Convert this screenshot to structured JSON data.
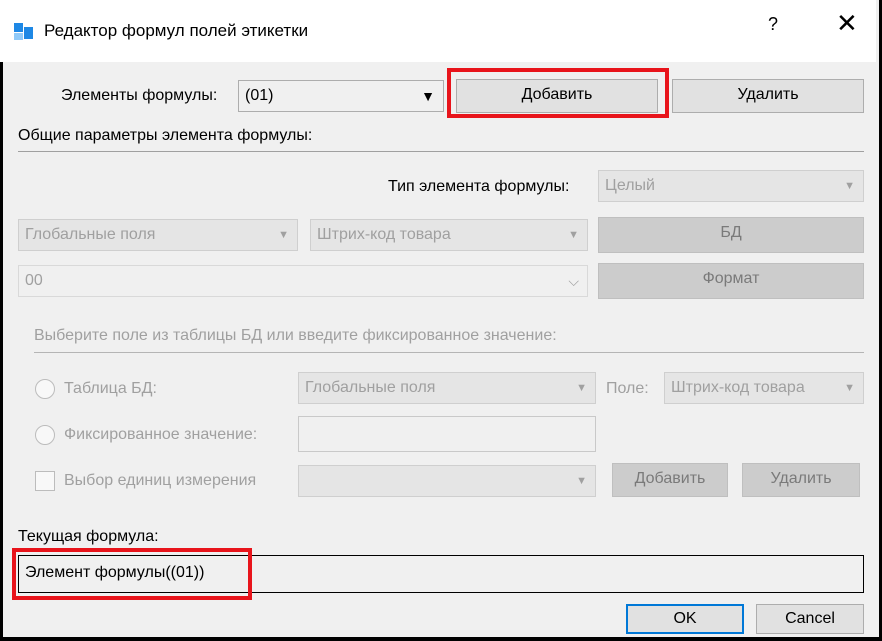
{
  "window": {
    "title": "Редактор формул полей этикетки",
    "help_label": "?",
    "close_label": "✕"
  },
  "top": {
    "elements_label": "Элементы формулы:",
    "elements_value": "(01)",
    "add_button": "Добавить",
    "delete_button": "Удалить"
  },
  "general": {
    "section_label": "Общие параметры элемента формулы:",
    "type_label": "Тип элемента формулы:",
    "type_value": "Целый",
    "source_value": "Глобальные поля",
    "field_value": "Штрих-код товара",
    "db_button": "БД",
    "value_text": "00",
    "format_button": "Формат"
  },
  "select": {
    "section_label": "Выберите поле из таблицы БД или введите фиксированное значение:",
    "table_radio_label": "Таблица БД:",
    "table_value": "Глобальные поля",
    "field_label": "Поле:",
    "field_value": "Штрих-код товара",
    "fixed_radio_label": "Фиксированное значение:",
    "fixed_value": "",
    "units_label": "Выбор единиц измерения",
    "units_value": "",
    "units_add_button": "Добавить",
    "units_delete_button": "Удалить"
  },
  "formula": {
    "label": "Текущая формула:",
    "value": "Элемент формулы((01))"
  },
  "footer": {
    "ok_button": "OK",
    "cancel_button": "Cancel"
  },
  "colors": {
    "highlight": "#e8141b",
    "accent": "#0078d7",
    "app_icon": "#1e88e5"
  },
  "icons": [
    "app-logo-icon",
    "help-icon",
    "close-icon",
    "dropdown-arrow-icon",
    "radio-icon",
    "checkbox-icon"
  ]
}
